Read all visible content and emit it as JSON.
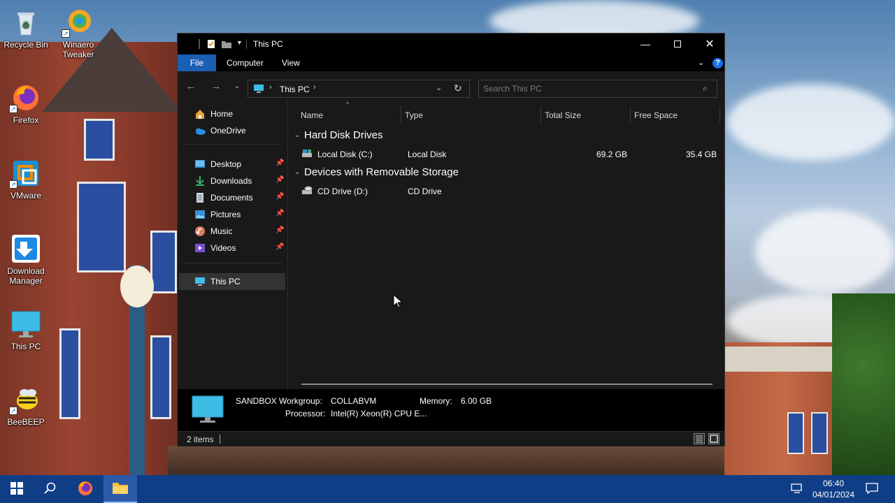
{
  "desktop": {
    "icons": [
      {
        "label": "Recycle Bin",
        "icon": "recycle-bin-icon"
      },
      {
        "label": "Winaero Tweaker",
        "icon": "winaero-tweaker-icon"
      },
      {
        "label": "Firefox",
        "icon": "firefox-icon"
      },
      {
        "label": "VMware",
        "icon": "vmware-icon"
      },
      {
        "label": "Download Manager",
        "icon": "download-manager-icon"
      },
      {
        "label": "This PC",
        "icon": "this-pc-icon"
      },
      {
        "label": "BeeBEEP",
        "icon": "beebeep-icon"
      }
    ]
  },
  "window": {
    "title": "This PC",
    "ribbon_tabs": [
      "File",
      "Computer",
      "View"
    ],
    "address": {
      "location": "This PC"
    },
    "search": {
      "placeholder": "Search This PC"
    },
    "nav_pane": {
      "top_items": [
        "Home",
        "OneDrive"
      ],
      "quick_access": [
        "Desktop",
        "Downloads",
        "Documents",
        "Pictures",
        "Music",
        "Videos"
      ],
      "this_pc": "This PC"
    },
    "columns": [
      "Name",
      "Type",
      "Total Size",
      "Free Space"
    ],
    "groups": [
      {
        "title": "Hard Disk Drives",
        "items": [
          {
            "name": "Local Disk (C:)",
            "type": "Local Disk",
            "total": "69.2 GB",
            "free": "35.4 GB"
          }
        ]
      },
      {
        "title": "Devices with Removable Storage",
        "items": [
          {
            "name": "CD Drive (D:)",
            "type": "CD Drive",
            "total": "",
            "free": ""
          }
        ]
      }
    ],
    "details": {
      "computer_name": "SANDBOX",
      "workgroup_label": "Workgroup:",
      "workgroup": "COLLABVM",
      "memory_label": "Memory:",
      "memory": "6.00 GB",
      "processor_label": "Processor:",
      "processor": "Intel(R) Xeon(R) CPU E..."
    },
    "status": {
      "items": "2 items"
    }
  },
  "taskbar": {
    "time": "06:40",
    "date": "04/01/2024"
  },
  "colors": {
    "taskbar": "#103e86",
    "accent": "#1a5fb4",
    "window_bg": "#191919",
    "titlebar": "#000000"
  }
}
